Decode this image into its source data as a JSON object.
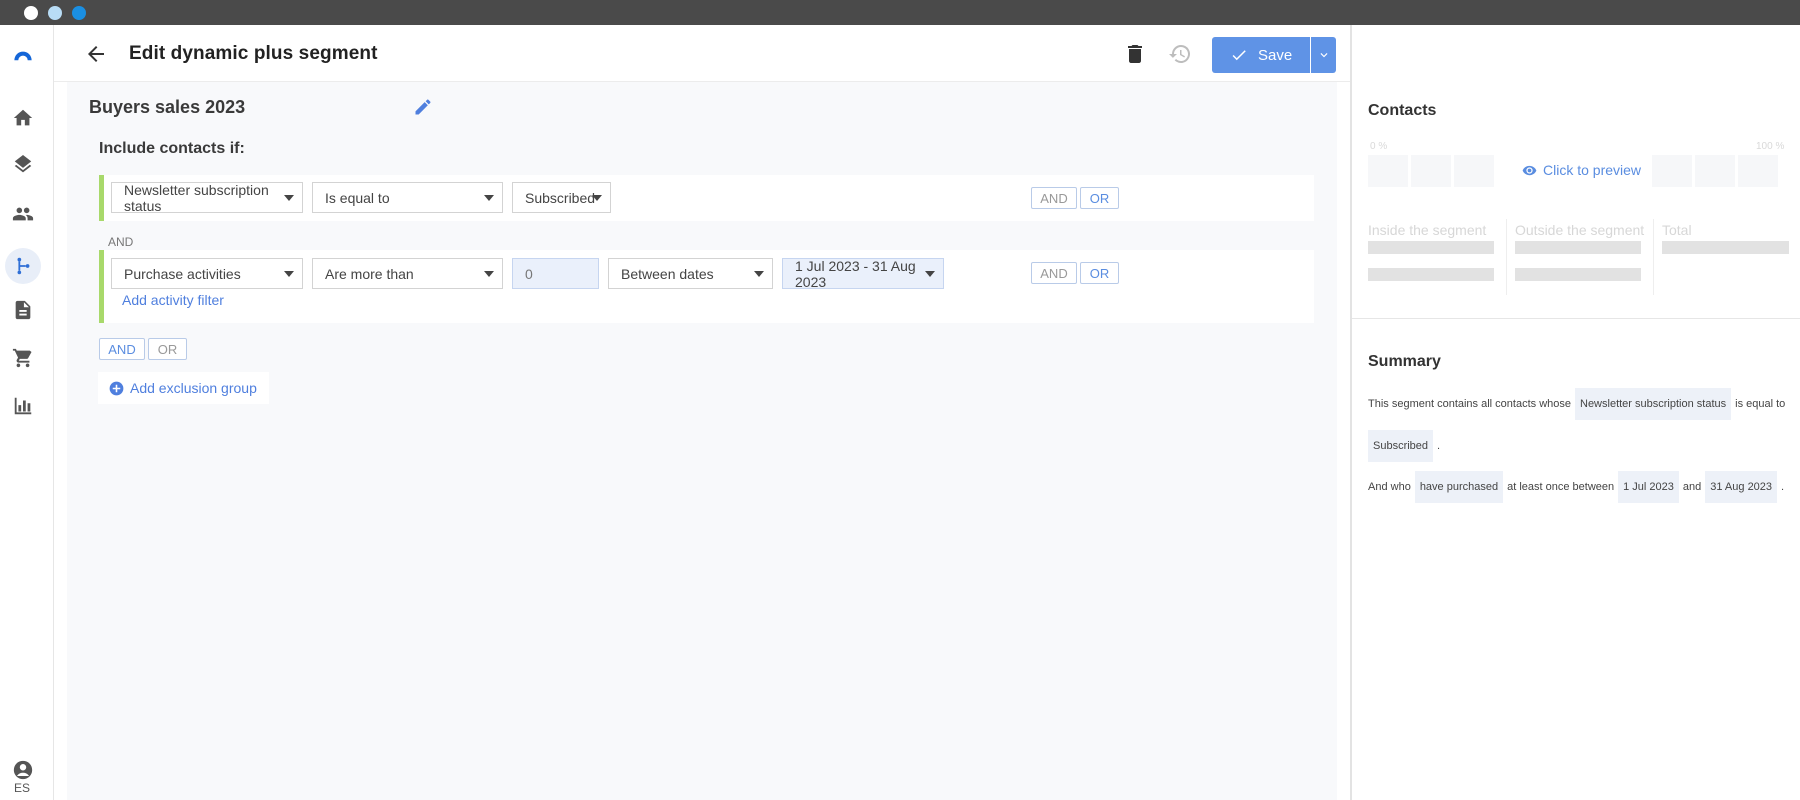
{
  "window": {
    "dots": [
      "#ffffff",
      "#b8dcf5",
      "#1a8fe3"
    ]
  },
  "rail": {
    "icons": [
      "logo-icon",
      "home-icon",
      "layers-icon",
      "contacts-icon",
      "segments-icon",
      "document-icon",
      "cart-icon",
      "reports-icon",
      "account-icon"
    ],
    "lang": "ES"
  },
  "header": {
    "title": "Edit dynamic plus segment",
    "save_label": "Save"
  },
  "segment": {
    "name": "Buyers sales 2023",
    "include_label": "Include contacts if:",
    "condition1": {
      "field": "Newsletter subscription status",
      "operator": "Is equal to",
      "value": "Subscribed",
      "and": "AND",
      "or": "OR"
    },
    "separator": "AND",
    "condition2": {
      "field": "Purchase activities",
      "operator": "Are more than",
      "count": "0",
      "period": "Between dates",
      "dates": "1 Jul 2023 - 31 Aug 2023",
      "and": "AND",
      "or": "OR",
      "add_filter": "Add activity filter"
    },
    "group_and": "AND",
    "group_or": "OR",
    "add_exclusion": "Add exclusion group"
  },
  "contacts": {
    "title": "Contacts",
    "pct_min": "0 %",
    "pct_max": "100 %",
    "preview": "Click to preview",
    "inside": "Inside the segment",
    "outside": "Outside the segment",
    "total": "Total"
  },
  "summary": {
    "title": "Summary",
    "line1_prefix": "This segment contains all contacts whose",
    "line1_chip": "Newsletter subscription status",
    "line1_suffix": "is equal to",
    "line2_chip": "Subscribed",
    "line2_suffix": ".",
    "line3_prefix": "And who",
    "line3_chip1": "have purchased",
    "line3_mid": "at least once between",
    "line3_chip2": "1 Jul 2023",
    "line3_and": "and",
    "line3_chip3": "31 Aug 2023",
    "line3_suffix": "."
  },
  "colors": {
    "accent": "#5f93e6",
    "link": "#4f7fde",
    "condition_border": "#a8d96b",
    "canvas": "#f8f9fb"
  }
}
